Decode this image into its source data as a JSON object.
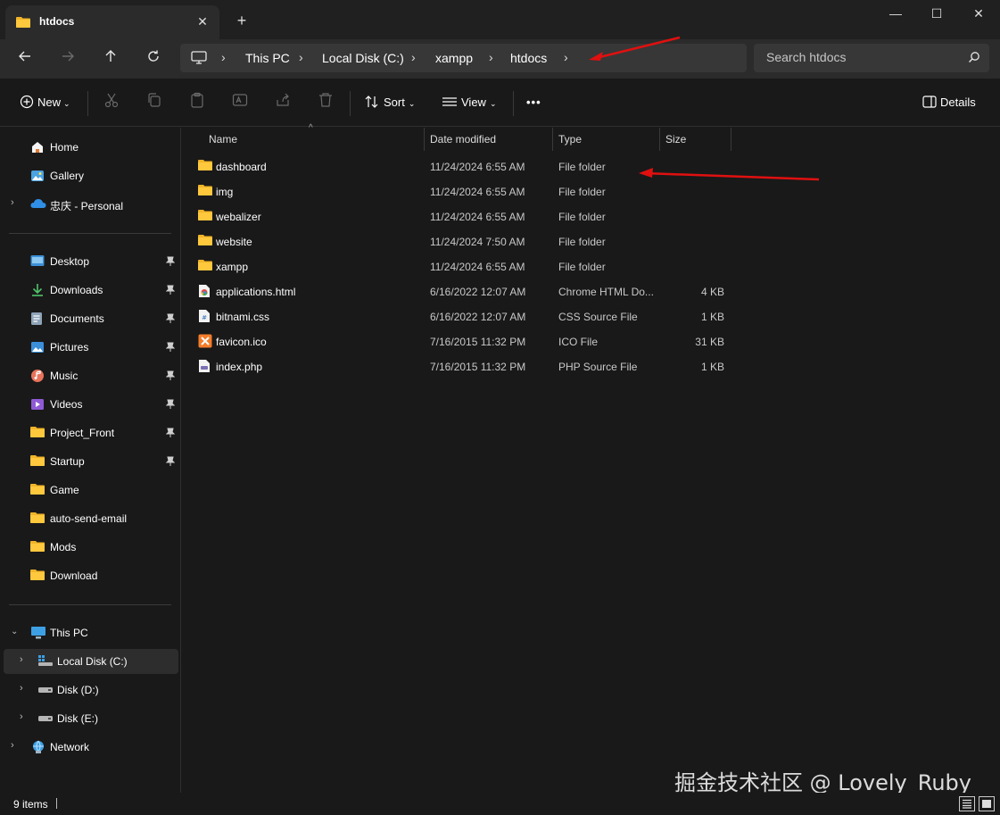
{
  "window": {
    "tab_title": "htdocs",
    "tab_close": "✕",
    "new_tab": "+",
    "minimize": "—",
    "maximize": "☐",
    "close": "✕"
  },
  "address": {
    "breadcrumb": [
      "This PC",
      "Local Disk (C:)",
      "xampp",
      "htdocs"
    ],
    "search_placeholder": "Search htdocs"
  },
  "commandbar": {
    "new_label": "New",
    "sort_label": "Sort",
    "view_label": "View",
    "more_label": "•••",
    "details_label": "Details"
  },
  "sidebar": {
    "top": [
      {
        "label": "Home",
        "icon": "home-icon"
      },
      {
        "label": "Gallery",
        "icon": "gallery-icon"
      },
      {
        "label": "忠庆 - Personal",
        "icon": "onedrive-icon"
      }
    ],
    "quick_access": [
      {
        "label": "Desktop",
        "icon": "desktop-icon",
        "pinned": true
      },
      {
        "label": "Downloads",
        "icon": "downloads-icon",
        "pinned": true
      },
      {
        "label": "Documents",
        "icon": "documents-icon",
        "pinned": true
      },
      {
        "label": "Pictures",
        "icon": "pictures-icon",
        "pinned": true
      },
      {
        "label": "Music",
        "icon": "music-icon",
        "pinned": true
      },
      {
        "label": "Videos",
        "icon": "videos-icon",
        "pinned": true
      },
      {
        "label": "Project_Front",
        "icon": "folder-icon",
        "pinned": true
      },
      {
        "label": "Startup",
        "icon": "folder-icon",
        "pinned": true
      },
      {
        "label": "Game",
        "icon": "folder-icon",
        "pinned": false
      },
      {
        "label": "auto-send-email",
        "icon": "folder-icon",
        "pinned": false
      },
      {
        "label": "Mods",
        "icon": "folder-icon",
        "pinned": false
      },
      {
        "label": "Download",
        "icon": "folder-icon",
        "pinned": false
      }
    ],
    "this_pc": {
      "label": "This PC",
      "icon": "computer-icon"
    },
    "drives": [
      {
        "label": "Local Disk (C:)",
        "icon": "windows-drive-icon",
        "selected": true
      },
      {
        "label": "Disk (D:)",
        "icon": "drive-icon",
        "selected": false
      },
      {
        "label": "Disk (E:)",
        "icon": "drive-icon",
        "selected": false
      }
    ],
    "network": {
      "label": "Network",
      "icon": "network-icon"
    }
  },
  "columns": {
    "name": "Name",
    "date": "Date modified",
    "type": "Type",
    "size": "Size"
  },
  "files": [
    {
      "name": "dashboard",
      "date": "11/24/2024 6:55 AM",
      "type": "File folder",
      "size": "",
      "icon": "folder-icon"
    },
    {
      "name": "img",
      "date": "11/24/2024 6:55 AM",
      "type": "File folder",
      "size": "",
      "icon": "folder-icon"
    },
    {
      "name": "webalizer",
      "date": "11/24/2024 6:55 AM",
      "type": "File folder",
      "size": "",
      "icon": "folder-icon"
    },
    {
      "name": "website",
      "date": "11/24/2024 7:50 AM",
      "type": "File folder",
      "size": "",
      "icon": "folder-icon"
    },
    {
      "name": "xampp",
      "date": "11/24/2024 6:55 AM",
      "type": "File folder",
      "size": "",
      "icon": "folder-icon"
    },
    {
      "name": "applications.html",
      "date": "6/16/2022 12:07 AM",
      "type": "Chrome HTML Do...",
      "size": "4 KB",
      "icon": "chrome-html-icon"
    },
    {
      "name": "bitnami.css",
      "date": "6/16/2022 12:07 AM",
      "type": "CSS Source File",
      "size": "1 KB",
      "icon": "css-file-icon"
    },
    {
      "name": "favicon.ico",
      "date": "7/16/2015 11:32 PM",
      "type": "ICO File",
      "size": "31 KB",
      "icon": "xampp-ico-icon"
    },
    {
      "name": "index.php",
      "date": "7/16/2015 11:32 PM",
      "type": "PHP Source File",
      "size": "1 KB",
      "icon": "php-file-icon"
    }
  ],
  "status": {
    "item_count": "9 items"
  },
  "watermark": "掘金技术社区 @ Lovely_Ruby",
  "colors": {
    "annotation_arrow": "#e01010",
    "folder": "#f0b429"
  }
}
